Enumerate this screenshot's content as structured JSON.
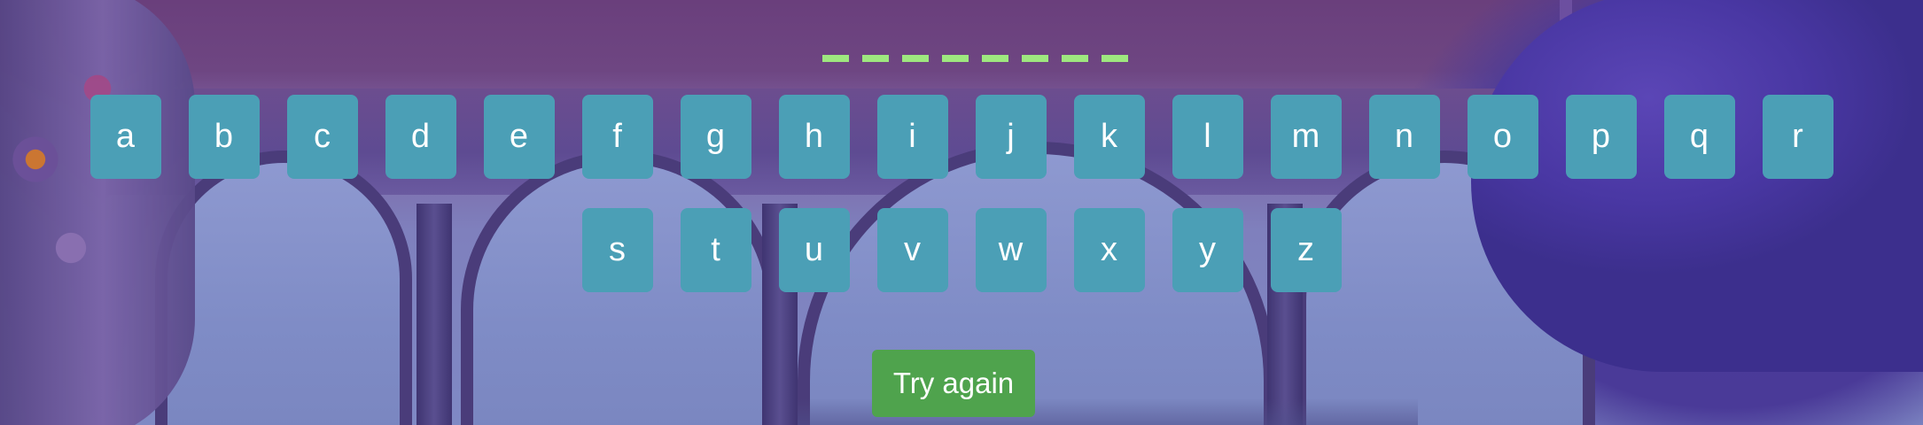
{
  "word": {
    "blanks": [
      "_",
      "_",
      "_",
      "_",
      "_",
      "_",
      "_",
      "_"
    ]
  },
  "keyboard": {
    "row1": [
      "a",
      "b",
      "c",
      "d",
      "e",
      "f",
      "g",
      "h",
      "i",
      "j",
      "k",
      "l",
      "m",
      "n",
      "o",
      "p",
      "q",
      "r"
    ],
    "row2": [
      "s",
      "t",
      "u",
      "v",
      "w",
      "x",
      "y",
      "z"
    ]
  },
  "actions": {
    "try_again_label": "Try again"
  },
  "colors": {
    "key_bg": "#4b9fb6",
    "blank": "#9ee77f",
    "try_again_bg": "#4fa34d"
  }
}
